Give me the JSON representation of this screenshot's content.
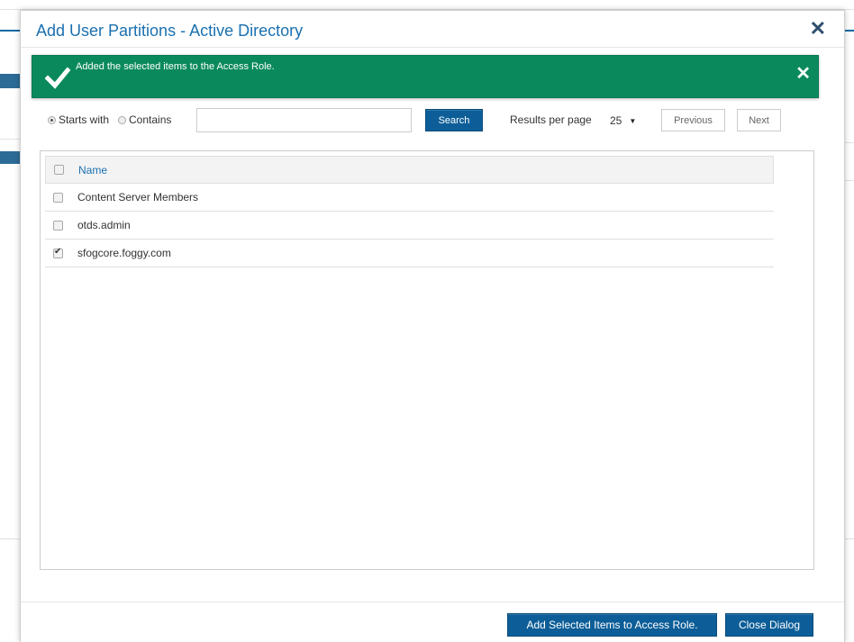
{
  "dialog": {
    "title": "Add User Partitions - Active Directory",
    "close_icon": "close-icon"
  },
  "banner": {
    "message": "Added the selected items to the Access Role.",
    "icon": "checkmark-icon",
    "close_icon": "close-icon",
    "color": "#0a8a5c"
  },
  "search": {
    "match_options": [
      {
        "label": "Starts with",
        "selected": true
      },
      {
        "label": "Contains",
        "selected": false
      }
    ],
    "input_value": "",
    "button_label": "Search",
    "results_per_page_label": "Results per page",
    "results_per_page_value": "25",
    "previous_label": "Previous",
    "next_label": "Next"
  },
  "table": {
    "header": "Name",
    "rows": [
      {
        "name": "Content Server Members",
        "checked": false
      },
      {
        "name": "otds.admin",
        "checked": false
      },
      {
        "name": "sfogcore.foggy.com",
        "checked": true
      }
    ]
  },
  "footer": {
    "add_label": "Add Selected Items to Access Role.",
    "close_label": "Close Dialog"
  },
  "colors": {
    "accent": "#1a70b0",
    "primary_button": "#0d5e98"
  }
}
